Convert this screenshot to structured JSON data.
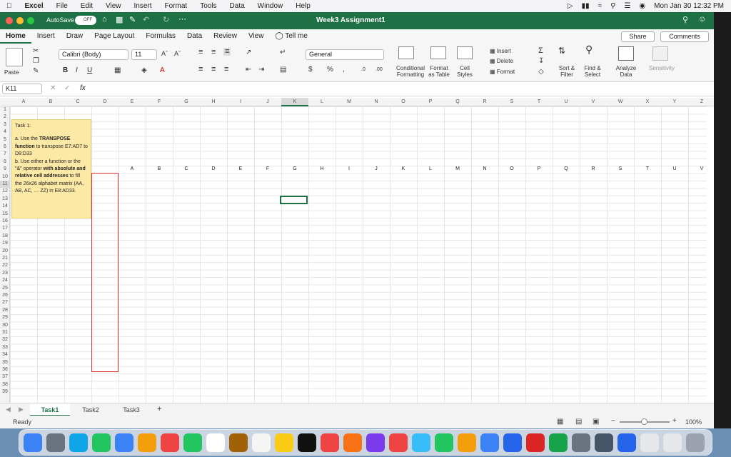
{
  "menubar": {
    "app": "Excel",
    "items": [
      "File",
      "Edit",
      "View",
      "Insert",
      "Format",
      "Tools",
      "Data",
      "Window",
      "Help"
    ],
    "clock": "Mon Jan 30  12:32 PM"
  },
  "titlebar": {
    "autosave_label": "AutoSave",
    "autosave_state": "OFF",
    "title": "Week3 Assignment1"
  },
  "ribbon": {
    "tabs": [
      "Home",
      "Insert",
      "Draw",
      "Page Layout",
      "Formulas",
      "Data",
      "Review",
      "View",
      "Tell me"
    ],
    "share_label": "Share",
    "comments_label": "Comments",
    "paste_label": "Paste",
    "font_name": "Calibri (Body)",
    "font_size": "11",
    "number_format": "General",
    "conditional_formatting": "Conditional Formatting",
    "format_as_table": "Format as Table",
    "cell_styles": "Cell Styles",
    "insert": "Insert",
    "delete": "Delete",
    "format": "Format",
    "sort_filter": "Sort & Filter",
    "find_select": "Find & Select",
    "analyze_data": "Analyze Data",
    "sensitivity": "Sensitivity"
  },
  "formula_bar": {
    "name_box": "K11",
    "fx": "fx",
    "content": ""
  },
  "columns": [
    "A",
    "B",
    "C",
    "D",
    "E",
    "F",
    "G",
    "H",
    "I",
    "J",
    "K",
    "L",
    "M",
    "N",
    "O",
    "P",
    "Q",
    "R",
    "S",
    "T",
    "U",
    "V",
    "W",
    "X",
    "Y",
    "Z"
  ],
  "rows": [
    "1",
    "2",
    "3",
    "4",
    "5",
    "6",
    "7",
    "8",
    "9",
    "10",
    "11",
    "12",
    "13",
    "14",
    "15",
    "16",
    "17",
    "18",
    "19",
    "20",
    "21",
    "22",
    "23",
    "24",
    "25",
    "26",
    "27",
    "28",
    "29",
    "30",
    "31",
    "32",
    "33",
    "34",
    "35",
    "36",
    "37",
    "38",
    "39"
  ],
  "row7_labels": [
    "A",
    "B",
    "C",
    "D",
    "E",
    "F",
    "G",
    "H",
    "I",
    "J",
    "K",
    "L",
    "M",
    "N",
    "O",
    "P",
    "Q",
    "R",
    "S",
    "T",
    "U",
    "V"
  ],
  "note": {
    "title": "Task 1:",
    "a_prefix": "a. Use the ",
    "a_bold1": "TRANSPOSE function",
    "a_rest": " to transpose E7:AD7 to D8:D33",
    "b_prefix": "b. Use either a function or the \"&\" operator ",
    "b_bold": "with absolute and relative cell addresses",
    "b_rest": " to fill the 26x26 alphabet matrix (AA, AB, AC, … ZZ) in E8:AD33."
  },
  "sheets": [
    "Task1",
    "Task2",
    "Task3"
  ],
  "status": {
    "ready": "Ready",
    "zoom": "100%"
  },
  "colors": {
    "excel_green": "#1e7145",
    "note_bg": "#fde9a6",
    "red_border": "#dd3333"
  }
}
